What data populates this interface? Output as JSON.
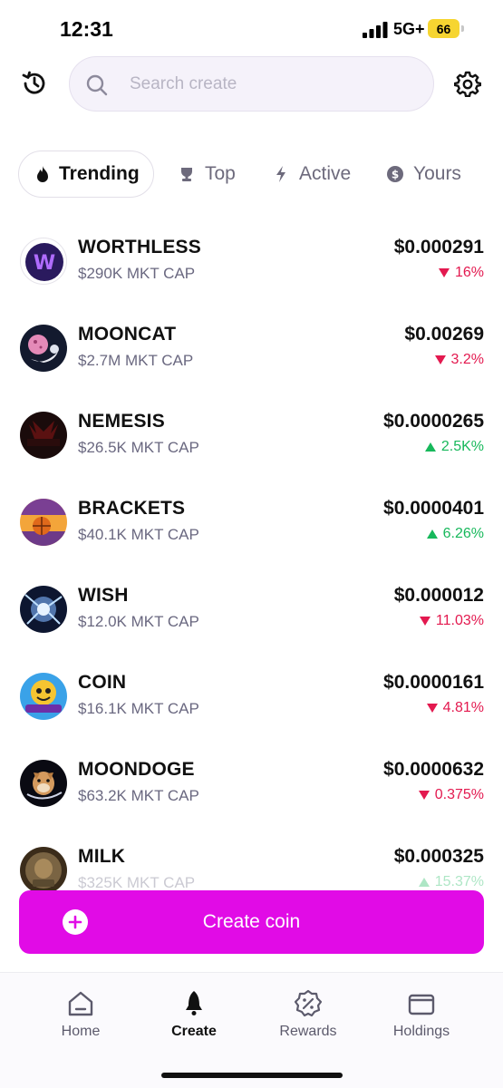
{
  "status_bar": {
    "time": "12:31",
    "network": "5G+",
    "battery": "66"
  },
  "search": {
    "placeholder": "Search create"
  },
  "tabs": [
    {
      "label": "Trending",
      "icon": "flame-icon",
      "active": true
    },
    {
      "label": "Top",
      "icon": "trophy-icon",
      "active": false
    },
    {
      "label": "Active",
      "icon": "lightning-icon",
      "active": false
    },
    {
      "label": "Yours",
      "icon": "coins-icon",
      "active": false
    }
  ],
  "coins": [
    {
      "name": "WORTHLESS",
      "cap": "$290K MKT CAP",
      "price": "$0.000291",
      "change": "16%",
      "direction": "down"
    },
    {
      "name": "MOONCAT",
      "cap": "$2.7M MKT CAP",
      "price": "$0.00269",
      "change": "3.2%",
      "direction": "down"
    },
    {
      "name": "NEMESIS",
      "cap": "$26.5K MKT CAP",
      "price": "$0.0000265",
      "change": "2.5K%",
      "direction": "up"
    },
    {
      "name": "BRACKETS",
      "cap": "$40.1K MKT CAP",
      "price": "$0.0000401",
      "change": "6.26%",
      "direction": "up"
    },
    {
      "name": "WISH",
      "cap": "$12.0K MKT CAP",
      "price": "$0.000012",
      "change": "11.03%",
      "direction": "down"
    },
    {
      "name": "COIN",
      "cap": "$16.1K MKT CAP",
      "price": "$0.0000161",
      "change": "4.81%",
      "direction": "down"
    },
    {
      "name": "MOONDOGE",
      "cap": "$63.2K MKT CAP",
      "price": "$0.0000632",
      "change": "0.375%",
      "direction": "down"
    },
    {
      "name": "MILK",
      "cap": "$325K MKT CAP",
      "price": "$0.000325",
      "change": "15.37%",
      "direction": "up"
    }
  ],
  "create_button": {
    "label": "Create coin"
  },
  "nav": {
    "home": "Home",
    "create": "Create",
    "rewards": "Rewards",
    "holdings": "Holdings"
  },
  "colors": {
    "accent": "#e10be6",
    "down": "#e3194f",
    "up": "#17b85b"
  }
}
